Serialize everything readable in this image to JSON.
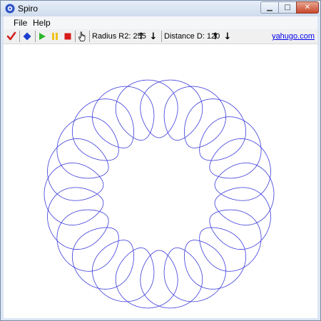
{
  "window": {
    "title": "Spiro"
  },
  "menu": [
    {
      "label": "File"
    },
    {
      "label": "Help"
    }
  ],
  "toolbar": {
    "check_icon": "check-icon",
    "diamond_icon": "diamond-icon",
    "play_icon": "play-icon",
    "pause_icon": "pause-icon",
    "stop_icon": "stop-icon",
    "hand_icon": "hand-icon",
    "radius_label": "Radius R2: 255",
    "distance_label": "Distance D: 120",
    "link_text": "yahugo.com",
    "up_arrow": "↑",
    "down_arrow": "↓"
  },
  "colors": {
    "curve": "#3a3adb",
    "check": "#d42020",
    "diamond": "#1c3fd0",
    "play": "#29b629",
    "pause": "#f1c21a",
    "stop": "#d71a1a"
  }
}
